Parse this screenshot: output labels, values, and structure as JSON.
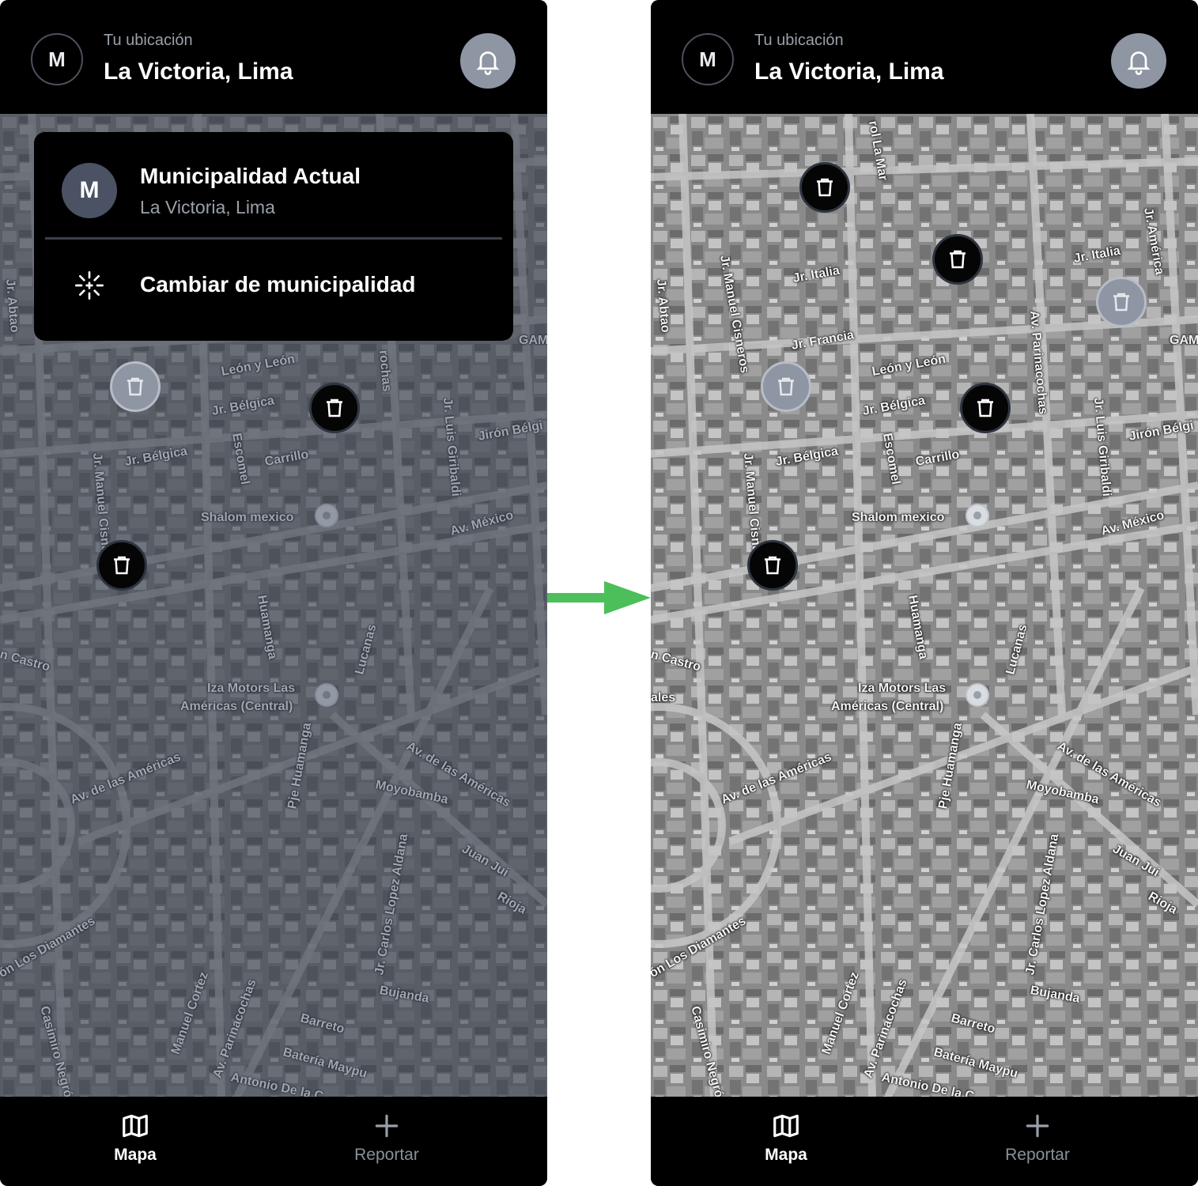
{
  "header": {
    "avatar_initial": "M",
    "location_label": "Tu ubicación",
    "location_value": "La Victoria, Lima"
  },
  "menu": {
    "avatar_initial": "M",
    "title": "Municipalidad Actual",
    "subtitle": "La Victoria, Lima",
    "change_label": "Cambiar de municipalidad"
  },
  "tabs": {
    "map": "Mapa",
    "report": "Reportar"
  },
  "map_labels": {
    "shalom": "Shalom mexico",
    "iza": "Iza Motors Las",
    "iza2": "Américas (Central)",
    "av_mexico": "Av. México",
    "av_americas": "Av. de las Américas",
    "av_americas2": "Av. de las Américas",
    "leon": "León y León",
    "belgica": "Jr. Bélgica",
    "belgica2": "Jr. Bélgica",
    "carrillo": "Carrillo",
    "escomel": "Escomel",
    "huamanga": "Huamanga",
    "lucanas": "Lucanas",
    "moyobamba": "Moyobamba",
    "juan_jui": "Juan Jui",
    "rioja": "Rioja",
    "bujanda": "Bujanda",
    "barreto": "Barreto",
    "bateria": "Batería Maypu",
    "antonio": "Antonio De la C",
    "castro": "n Castro",
    "diamantes": "ón Los Diamantes",
    "casimiro": "Casimiro Negrón",
    "manuel_cortez": "Manuel Cortez",
    "parinacochas": "Av. Parinacochas",
    "carlos_lopez": "Jr. Carlos Lopez Aldana",
    "pje_huamanga": "Pje Huamanga",
    "giribaldi": "Jr. Luis Giribaldi",
    "jiron_belgica": "Jirón Bélgi",
    "jr_abtao": "Jr. Abtao",
    "manuel_cisneros": "Jr. Manuel Cisneros",
    "italia": "Jr. Italia",
    "italia2": "Jr. Italia",
    "francia": "Jr. Francia",
    "america": "Jr. América",
    "la_mar": "rol La Mar",
    "gam": "GAM",
    "nales": "ales",
    "cochas": "rochas",
    "av_parinacochas2": "Av. Parinacochas"
  }
}
